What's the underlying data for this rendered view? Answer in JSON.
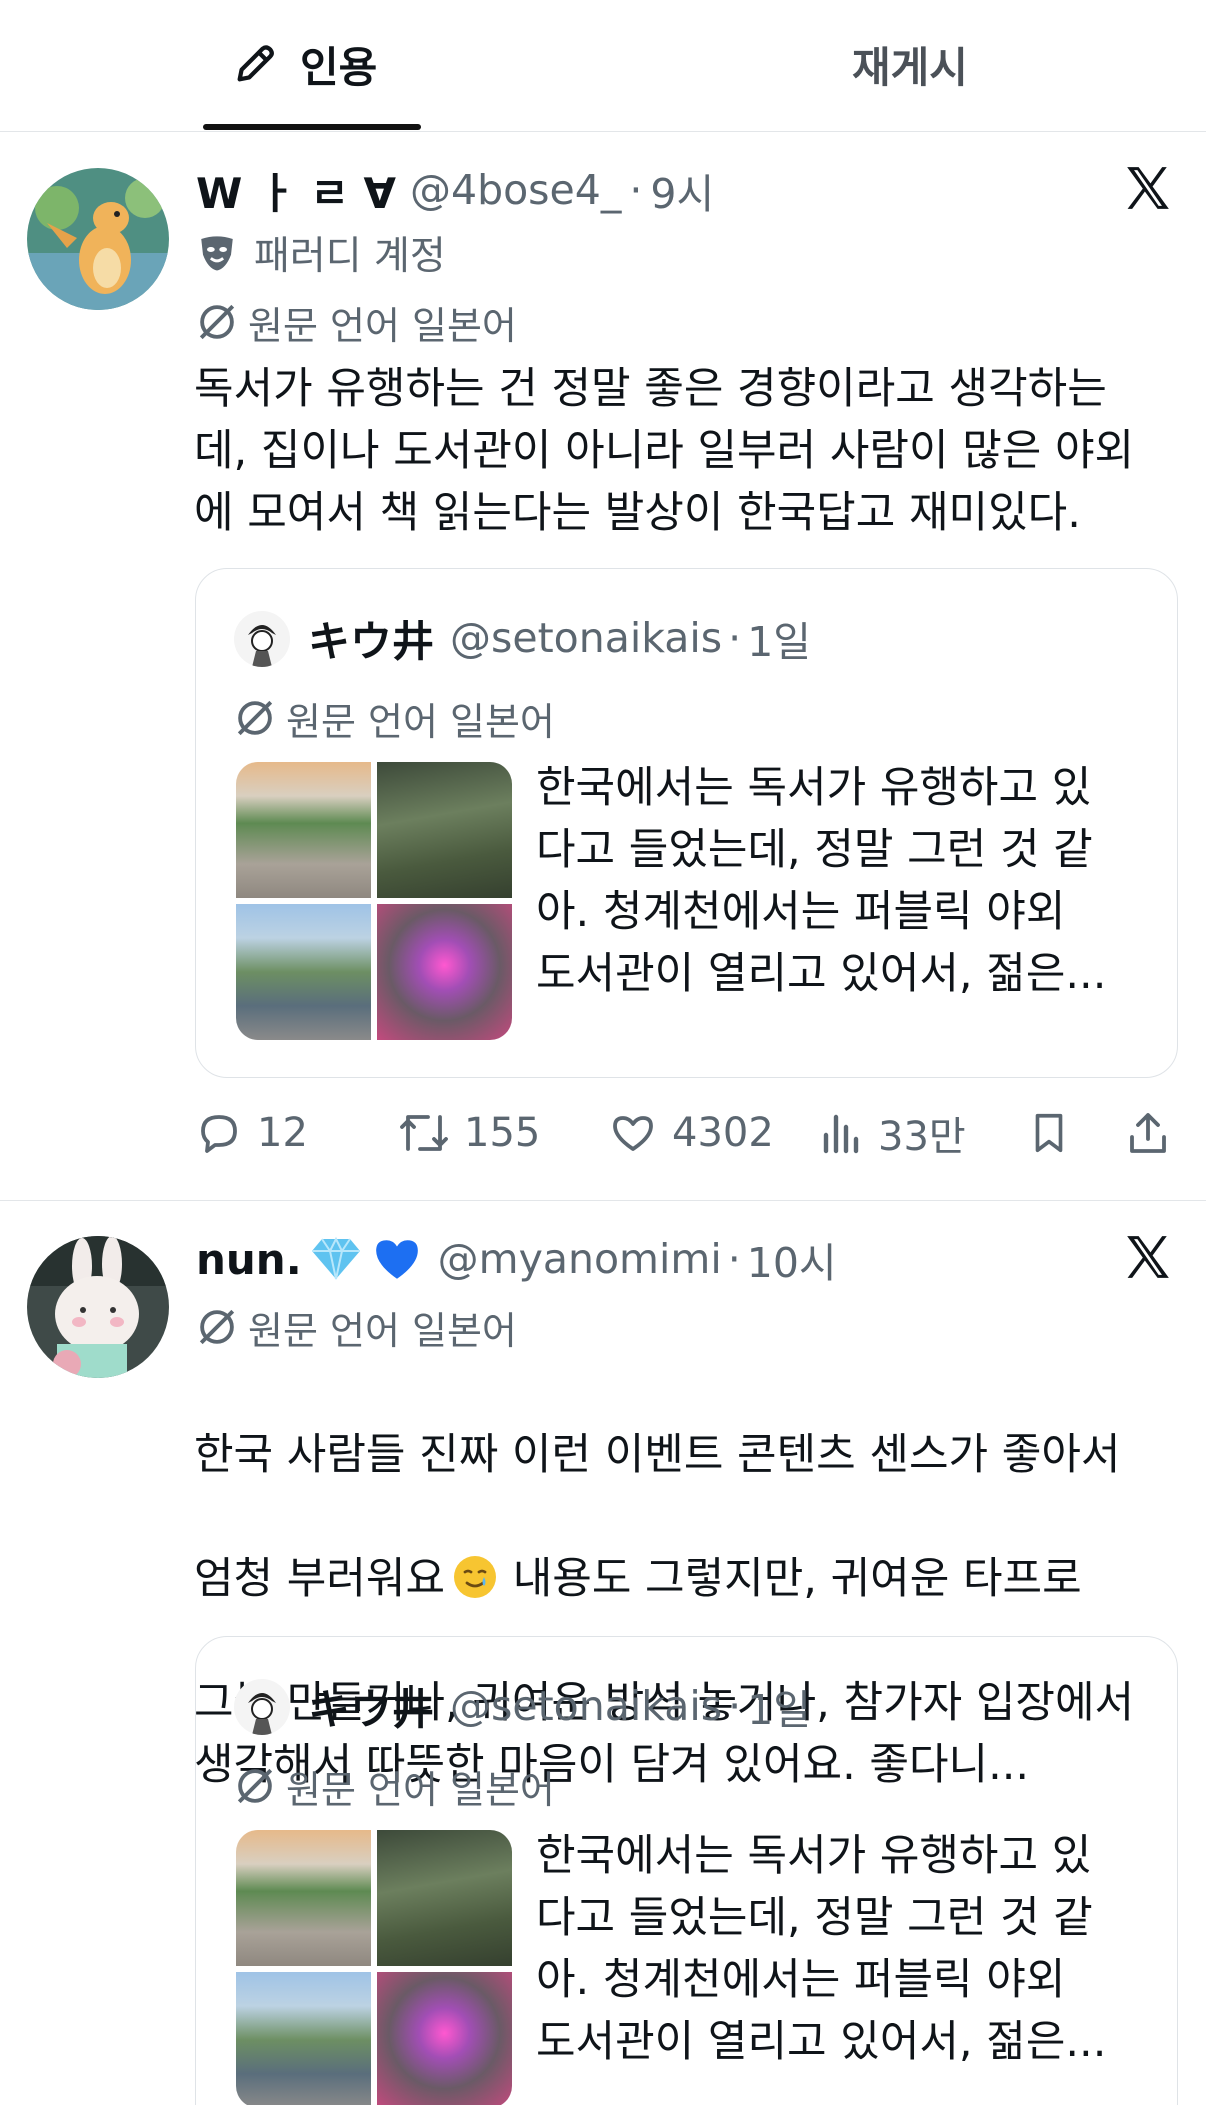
{
  "tabs": {
    "quotes_label": "인용",
    "reposts_label": "재게시"
  },
  "post1": {
    "display_name": "W ㅏ ㄹ ∀",
    "handle": "@4bose4_",
    "sep": "·",
    "time": "9시",
    "badge": "패러디 계정",
    "translate_label": "원문 언어 일본어",
    "text": "독서가 유행하는 건 정말 좋은 경향이라고 생각하는\n데, 집이나 도서관이 아니라 일부러 사람이 많은 야외\n에 모여서 책 읽는다는 발상이 한국답고 재미있다.",
    "quote": {
      "display_name": "キウ井",
      "handle": "@setonaikais",
      "sep": "·",
      "time": "1일",
      "translate_label": "원문 언어 일본어",
      "text": "한국에서는 독서가 유행하고 있\n다고 들었는데, 정말 그런 것 같\n아. 청계천에서는 퍼블릭 야외\n도서관이 열리고 있어서, 젊은..."
    },
    "actions": {
      "replies": "12",
      "reposts": "155",
      "likes": "4302",
      "views": "33만"
    }
  },
  "post2": {
    "display_name": "nun.",
    "emojis": "💎💙",
    "handle": "@myanomimi",
    "sep": "·",
    "time": "10시",
    "translate_label": "원문 언어 일본어",
    "text_line1": "한국 사람들 진짜 이런 이벤트 콘텐츠 센스가 좋아서",
    "text_line2a": "엄청 부러워요",
    "text_line2b": " 내용도 그렇지만, 귀여운 타프로",
    "text_rest": "그늘 만들거나, 귀여운 방석 놓거나, 참가자 입장에서\n생각해서 따뜻한 마음이 담겨 있어요. 좋다니...",
    "quote": {
      "display_name": "キウ井",
      "handle": "@setonaikais",
      "sep": "·",
      "time": "1일",
      "translate_label": "원문 언어 일본어",
      "text": "한국에서는 독서가 유행하고 있\n다고 들었는데, 정말 그런 것 같\n아. 청계천에서는 퍼블릭 야외\n도서관이 열리고 있어서, 젊은..."
    }
  },
  "colors": {
    "text": "#0f1419",
    "muted": "#5b6670",
    "border": "#e3e6e9",
    "diamond": "#5fc3f0",
    "heart_blue": "#1d6ff2"
  },
  "icons": [
    "pencil-icon",
    "x-logo-icon",
    "parody-mask-icon",
    "translate-icon",
    "reply-icon",
    "repost-icon",
    "like-icon",
    "views-icon",
    "bookmark-icon",
    "share-icon",
    "diamond-emoji",
    "blue-heart-emoji",
    "teary-smile-emoji"
  ]
}
